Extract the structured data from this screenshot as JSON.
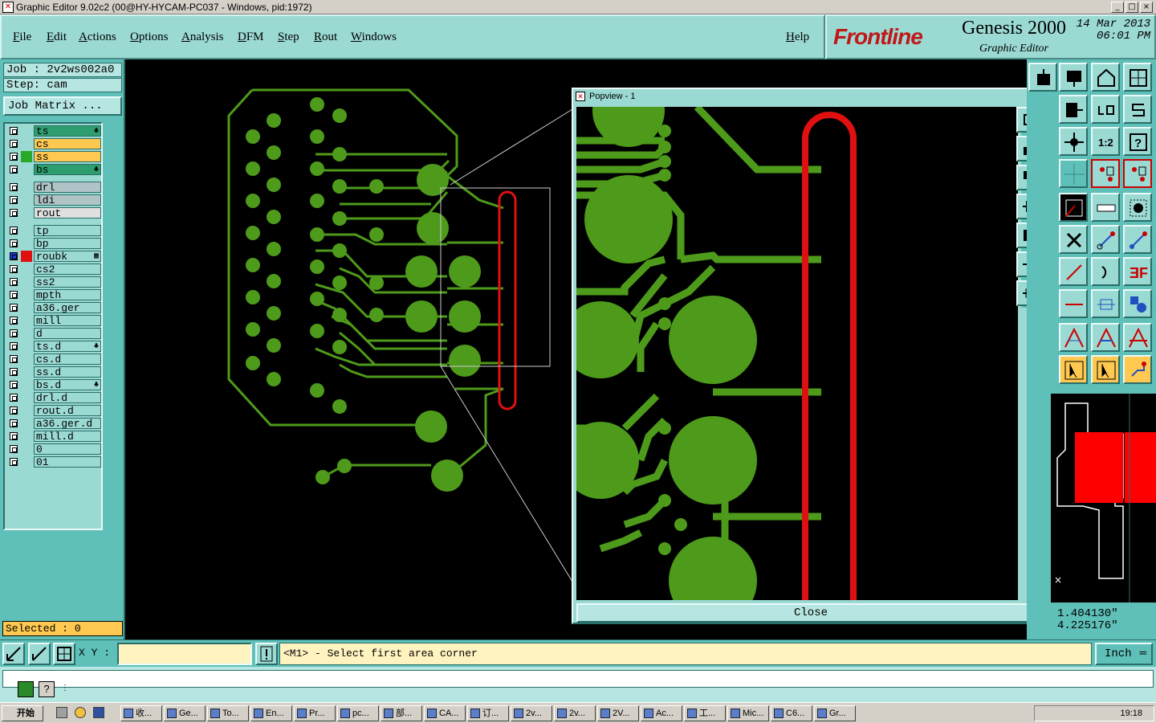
{
  "window": {
    "title": "Graphic Editor 9.02c2 (00@HY-HYCAM-PC037 - Windows, pid:1972)"
  },
  "menu": [
    "File",
    "Edit",
    "Actions",
    "Options",
    "Analysis",
    "DFM",
    "Step",
    "Rout",
    "Windows"
  ],
  "help": "Help",
  "brand": {
    "logo": "Frontline",
    "product": "Genesis 2000",
    "subtitle": "Graphic Editor",
    "date": "14 Mar 2013",
    "time": "06:01 PM"
  },
  "job": {
    "job_line": "Job : 2v2ws002a0",
    "step_line": "Step: cam",
    "matrix_button": "Job Matrix ..."
  },
  "layers": [
    {
      "name": "ts",
      "bg": "#2e9e6e",
      "sw": "",
      "mark": "♣"
    },
    {
      "name": "cs",
      "bg": "#ffc850",
      "sw": "",
      "mark": ""
    },
    {
      "name": "ss",
      "bg": "#ffc850",
      "sw": "#2aa82a",
      "mark": ""
    },
    {
      "name": "bs",
      "bg": "#2e9e6e",
      "sw": "",
      "mark": "♣"
    },
    {
      "name": "drl",
      "bg": "#b0c4c8",
      "sw": "",
      "mark": ""
    },
    {
      "name": "ldi",
      "bg": "#b0c4c8",
      "sw": "",
      "mark": ""
    },
    {
      "name": "rout",
      "bg": "#e0e0e0",
      "sw": "",
      "mark": ""
    },
    {
      "name": "tp",
      "bg": "#9bd9d3",
      "sw": "",
      "mark": ""
    },
    {
      "name": "bp",
      "bg": "#9bd9d3",
      "sw": "",
      "mark": ""
    },
    {
      "name": "roubk",
      "bg": "#9bd9d3",
      "sw": "#e01010",
      "mark": "▦"
    },
    {
      "name": "cs2",
      "bg": "#9bd9d3",
      "sw": "",
      "mark": ""
    },
    {
      "name": "ss2",
      "bg": "#9bd9d3",
      "sw": "",
      "mark": ""
    },
    {
      "name": "mpth",
      "bg": "#9bd9d3",
      "sw": "",
      "mark": ""
    },
    {
      "name": "a36.ger",
      "bg": "#9bd9d3",
      "sw": "",
      "mark": ""
    },
    {
      "name": "mill",
      "bg": "#9bd9d3",
      "sw": "",
      "mark": ""
    },
    {
      "name": "d",
      "bg": "#9bd9d3",
      "sw": "",
      "mark": ""
    },
    {
      "name": "ts.d",
      "bg": "#9bd9d3",
      "sw": "",
      "mark": "♣"
    },
    {
      "name": "cs.d",
      "bg": "#9bd9d3",
      "sw": "",
      "mark": ""
    },
    {
      "name": "ss.d",
      "bg": "#9bd9d3",
      "sw": "",
      "mark": ""
    },
    {
      "name": "bs.d",
      "bg": "#9bd9d3",
      "sw": "",
      "mark": "♣"
    },
    {
      "name": "drl.d",
      "bg": "#9bd9d3",
      "sw": "",
      "mark": ""
    },
    {
      "name": "rout.d",
      "bg": "#9bd9d3",
      "sw": "",
      "mark": ""
    },
    {
      "name": "a36.ger.d",
      "bg": "#9bd9d3",
      "sw": "",
      "mark": ""
    },
    {
      "name": "mill.d",
      "bg": "#9bd9d3",
      "sw": "",
      "mark": ""
    },
    {
      "name": "0",
      "bg": "#9bd9d3",
      "sw": "",
      "mark": ""
    },
    {
      "name": "01",
      "bg": "#9bd9d3",
      "sw": "",
      "mark": ""
    }
  ],
  "selected": "Selected : 0",
  "popview": {
    "title": "Popview - 1",
    "close": "Close"
  },
  "coords": {
    "x": "1.404130\"",
    "y": "4.225176\""
  },
  "xy_label": "X Y :",
  "xy_value": "",
  "prompt": "<M1> - Select first area corner",
  "units": "Inch",
  "taskbar": {
    "start": "开始",
    "items": [
      "收...",
      "Ge...",
      "To...",
      "En...",
      "Pr...",
      "pc...",
      "部...",
      "CA...",
      "订...",
      "2v...",
      "2v...",
      "2V...",
      "Ac...",
      "工...",
      "Mic...",
      "C6...",
      "Gr..."
    ],
    "clock": "19:18"
  },
  "colors": {
    "copper": "#4e9a1a",
    "rout": "#e01010",
    "panel": "#5ec0b8",
    "panel_light": "#9bd9d3",
    "highlight": "#ffc850"
  }
}
